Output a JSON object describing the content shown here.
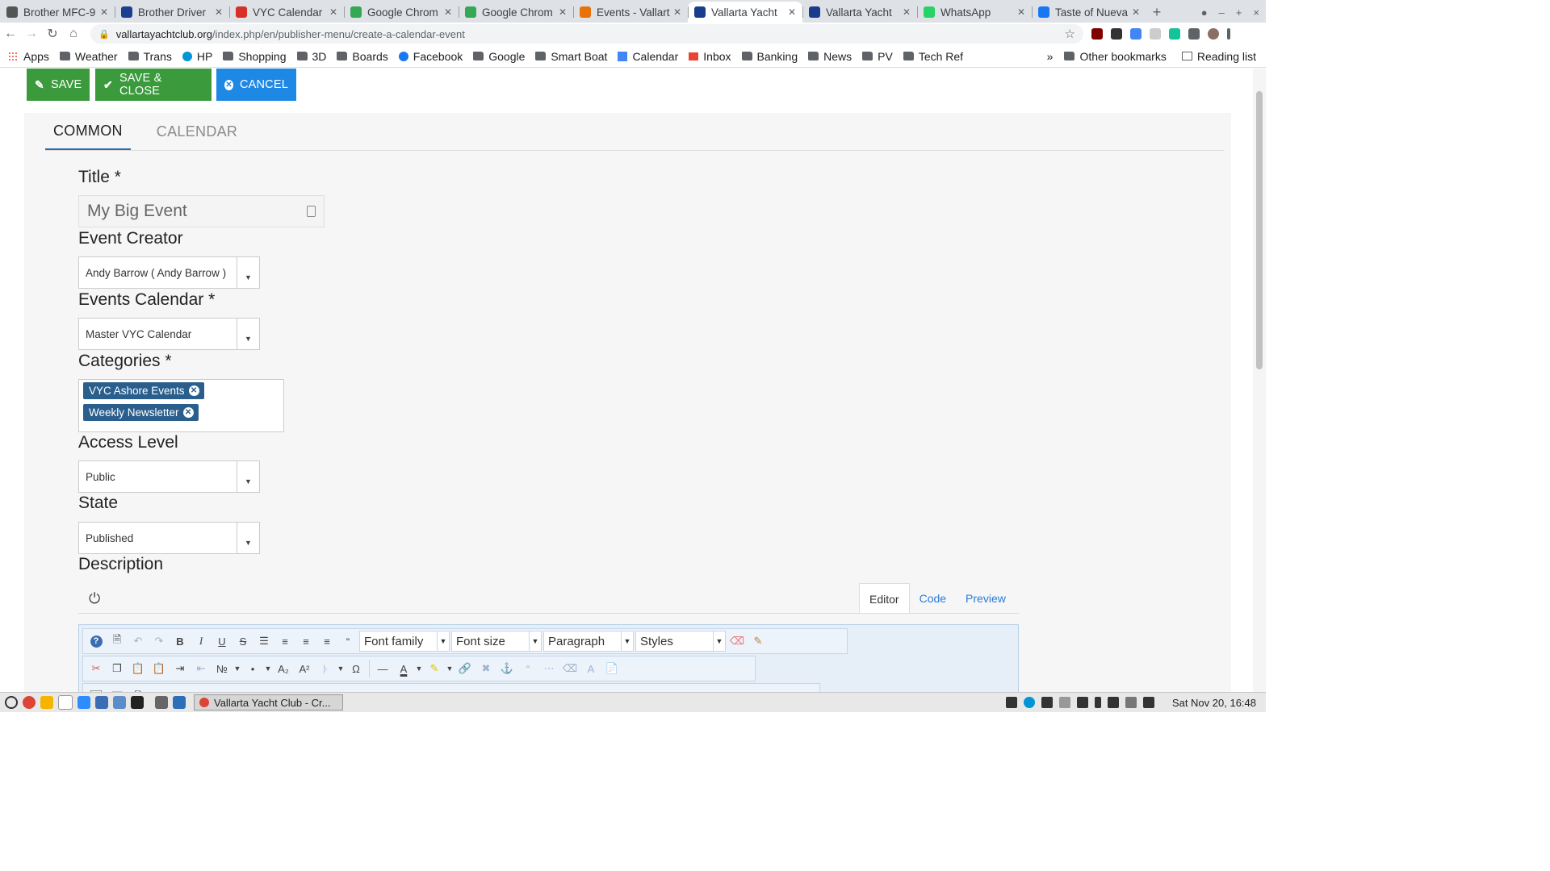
{
  "browser": {
    "tabs": [
      {
        "title": "Brother MFC-9",
        "favcolor": "#555555"
      },
      {
        "title": "Brother Driver",
        "favcolor": "#1d3f8f"
      },
      {
        "title": "VYC Calendar",
        "favcolor": "#d93025"
      },
      {
        "title": "Google Chrom",
        "favcolor": "#34a853"
      },
      {
        "title": "Google Chrom",
        "favcolor": "#34a853"
      },
      {
        "title": "Events - Vallart",
        "favcolor": "#e8710a"
      },
      {
        "title": "Vallarta Yacht",
        "favcolor": "#1a3c8c",
        "active": true
      },
      {
        "title": "Vallarta Yacht",
        "favcolor": "#1a3c8c"
      },
      {
        "title": "WhatsApp",
        "favcolor": "#25d366"
      },
      {
        "title": "Taste of Nueva",
        "favcolor": "#1877f2"
      }
    ],
    "url_host": "vallartayachtclub.org",
    "url_path": "/index.php/en/publisher-menu/create-a-calendar-event",
    "bookmarks": [
      {
        "label": "Apps",
        "icon": "apps-grid-icon"
      },
      {
        "label": "Weather",
        "icon": "folder-icon"
      },
      {
        "label": "Trans",
        "icon": "folder-icon"
      },
      {
        "label": "HP",
        "icon": "hp-icon"
      },
      {
        "label": "Shopping",
        "icon": "folder-icon"
      },
      {
        "label": "3D",
        "icon": "folder-icon"
      },
      {
        "label": "Boards",
        "icon": "folder-icon"
      },
      {
        "label": "Facebook",
        "icon": "facebook-icon"
      },
      {
        "label": "Google",
        "icon": "folder-icon"
      },
      {
        "label": "Smart Boat",
        "icon": "folder-icon"
      },
      {
        "label": "Calendar",
        "icon": "calendar-icon"
      },
      {
        "label": "Inbox",
        "icon": "gmail-icon"
      },
      {
        "label": "Banking",
        "icon": "folder-icon"
      },
      {
        "label": "News",
        "icon": "folder-icon"
      },
      {
        "label": "PV",
        "icon": "folder-icon"
      },
      {
        "label": "Tech Ref",
        "icon": "folder-icon"
      }
    ],
    "overflow": "»",
    "other_bookmarks": "Other bookmarks",
    "reading_list": "Reading list"
  },
  "actions": {
    "save": "SAVE",
    "save_close": "SAVE & CLOSE",
    "cancel": "CANCEL",
    "save_color": "#3a9a3c",
    "cancel_color": "#1e88e5"
  },
  "form_tabs": [
    "COMMON",
    "CALENDAR"
  ],
  "form": {
    "title_label": "Title *",
    "title_value": "My Big Event",
    "creator_label": "Event Creator",
    "creator_value": "Andy Barrow ( Andy Barrow )",
    "calendar_label": "Events Calendar *",
    "calendar_value": "Master VYC Calendar",
    "categories_label": "Categories *",
    "categories": [
      "VYC Ashore Events",
      "Weekly Newsletter"
    ],
    "access_label": "Access Level",
    "access_value": "Public",
    "state_label": "State",
    "state_value": "Published",
    "description_label": "Description"
  },
  "editor": {
    "tabs": [
      "Editor",
      "Code",
      "Preview"
    ],
    "font_family": "Font family",
    "font_size": "Font size",
    "paragraph": "Paragraph",
    "styles": "Styles"
  },
  "taskbar": {
    "window_title": "Vallarta Yacht Club - Cr...",
    "clock": "Sat Nov 20, 16:48"
  }
}
